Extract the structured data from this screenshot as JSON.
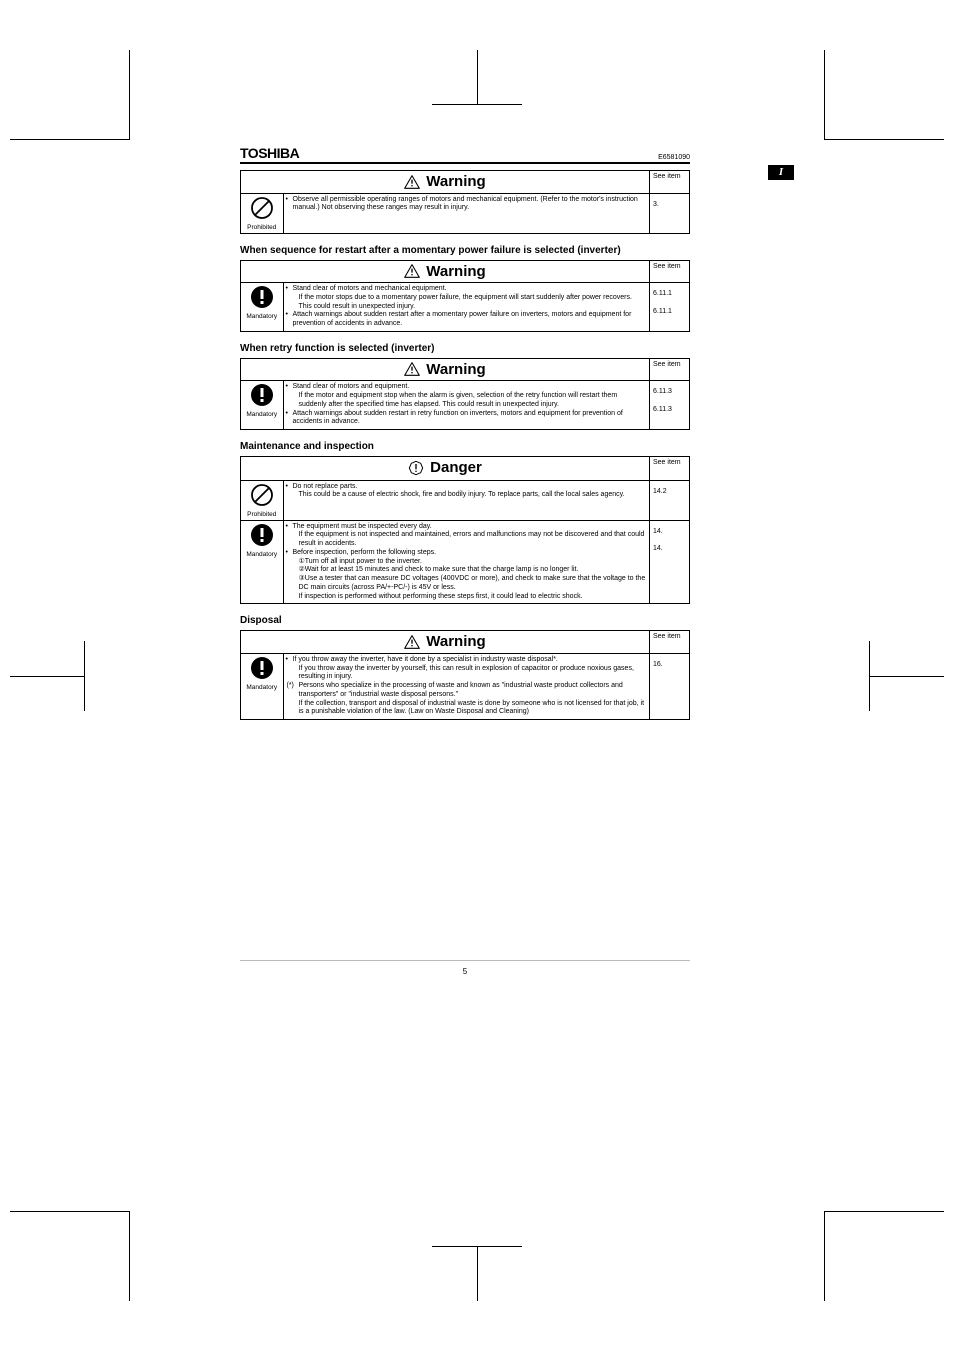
{
  "header": {
    "brand": "TOSHIBA",
    "docnum": "E6581090"
  },
  "side_tab": "I",
  "labels": {
    "see_item": "See item",
    "prohibited": "Prohibited",
    "mandatory": "Mandatory"
  },
  "banners": {
    "warning": "Warning",
    "danger": "Danger"
  },
  "sections": [
    {
      "title": "",
      "banner": "warning",
      "rows": [
        {
          "icon": "prohibited",
          "items": [
            {
              "text": "Observe all permissible operating ranges of motors and mechanical equipment. (Refer to the motor's instruction manual.) Not observing these ranges may result in injury.",
              "ref": "3."
            }
          ]
        }
      ]
    },
    {
      "title": "When sequence for restart after a momentary power failure is selected (inverter)",
      "banner": "warning",
      "rows": [
        {
          "icon": "mandatory",
          "items": [
            {
              "text": "Stand clear of motors and mechanical equipment.",
              "sub": "If the motor stops due to a momentary power failure, the equipment will start suddenly after power recovers. This could result in unexpected injury.",
              "ref": "6.11.1"
            },
            {
              "text": "Attach warnings about sudden restart after a momentary power failure on inverters, motors and equipment for prevention of accidents in advance.",
              "ref": "6.11.1"
            }
          ]
        }
      ]
    },
    {
      "title": "When retry function is selected (inverter)",
      "banner": "warning",
      "rows": [
        {
          "icon": "mandatory",
          "items": [
            {
              "text": "Stand clear of motors and equipment.",
              "sub": "If the motor and equipment stop when the alarm is given, selection of the retry function will restart them suddenly after the specified time has elapsed. This could result in unexpected injury.",
              "ref": "6.11.3"
            },
            {
              "text": "Attach warnings about sudden restart in retry function on inverters, motors and equipment for prevention of accidents in advance.",
              "ref": "6.11.3"
            }
          ]
        }
      ]
    },
    {
      "title": "Maintenance and inspection",
      "banner": "danger",
      "rows": [
        {
          "icon": "prohibited",
          "items": [
            {
              "text": "Do not replace parts.",
              "sub": "This could be a cause of electric shock, fire and bodily injury. To replace parts, call the local sales agency.",
              "ref": "14.2"
            }
          ]
        },
        {
          "icon": "mandatory",
          "items": [
            {
              "text": "The equipment must be inspected every day.",
              "sub": "If the equipment is not inspected and maintained, errors and malfunctions may not be discovered and that could result in accidents.",
              "ref": "14."
            },
            {
              "text": "Before inspection, perform the following steps.",
              "sub": "①Turn off all input power to the inverter.\n②Wait for at least 15 minutes and check to make sure that the charge lamp is no longer lit.\n③Use a tester that can measure DC voltages (400VDC or more), and check to make sure that the voltage to the DC main circuits (across PA/+-PC/-) is 45V or less.\nIf inspection is performed without performing these steps first, it could lead to electric shock.",
              "ref": "14."
            }
          ]
        }
      ]
    },
    {
      "title": "Disposal",
      "banner": "warning",
      "rows": [
        {
          "icon": "mandatory",
          "items": [
            {
              "text": "If you throw away the inverter, have it done by a specialist in industry waste disposal*.",
              "sub": "If you throw away the inverter by yourself, this can result in explosion of capacitor or produce noxious gases, resulting in injury.",
              "ref": "16."
            },
            {
              "prefix": "(*)",
              "text": "Persons who specialize in the processing of waste and known as \"industrial waste product collectors and transporters\" or \"industrial waste disposal persons.\"",
              "sub": "If the collection, transport and disposal of industrial waste is done by someone who is not licensed for that job, it is a punishable violation of the law. (Law on Waste Disposal and Cleaning)"
            }
          ]
        }
      ]
    }
  ],
  "page_number": "5"
}
